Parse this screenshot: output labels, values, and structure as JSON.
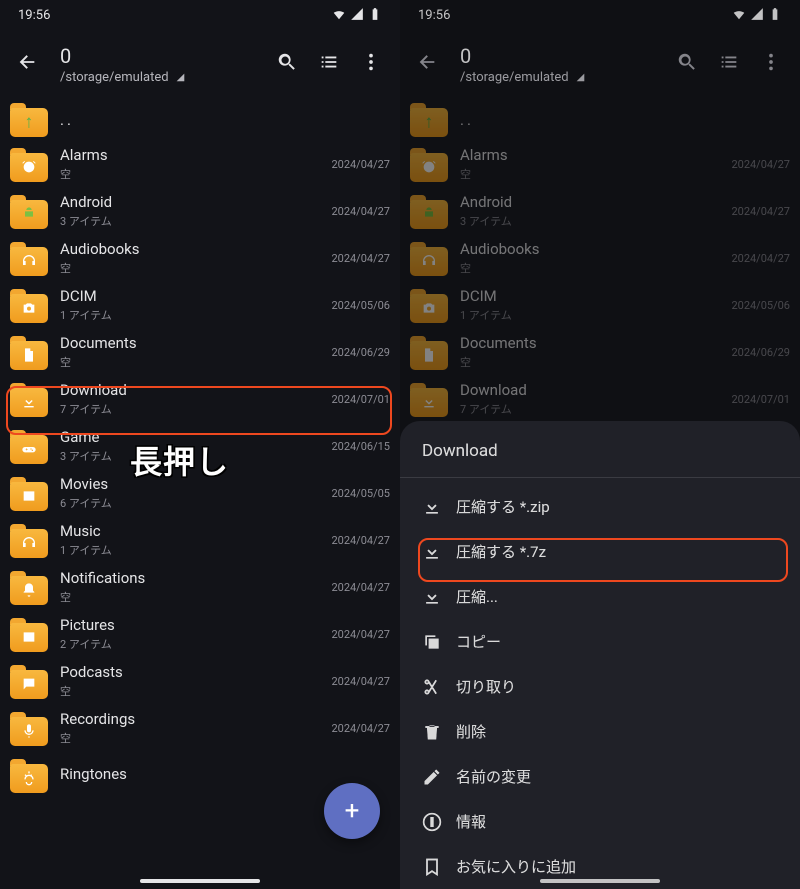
{
  "statusbar": {
    "time": "19:56"
  },
  "header": {
    "title": "0",
    "path": "/storage/emulated",
    "up_label": ".."
  },
  "folders": [
    {
      "name": "Alarms",
      "sub": "空",
      "date": "2024/04/27",
      "icon": "alarm"
    },
    {
      "name": "Android",
      "sub": "3 アイテム",
      "date": "2024/04/27",
      "icon": "android"
    },
    {
      "name": "Audiobooks",
      "sub": "空",
      "date": "2024/04/27",
      "icon": "headphones"
    },
    {
      "name": "DCIM",
      "sub": "1 アイテム",
      "date": "2024/05/06",
      "icon": "camera"
    },
    {
      "name": "Documents",
      "sub": "空",
      "date": "2024/06/29",
      "icon": "document"
    },
    {
      "name": "Download",
      "sub": "7 アイテム",
      "date": "2024/07/01",
      "icon": "download"
    },
    {
      "name": "Game",
      "sub": "3 アイテム",
      "date": "2024/06/15",
      "icon": "game"
    },
    {
      "name": "Movies",
      "sub": "6 アイテム",
      "date": "2024/05/05",
      "icon": "movie"
    },
    {
      "name": "Music",
      "sub": "1 アイテム",
      "date": "2024/04/27",
      "icon": "headphones"
    },
    {
      "name": "Notifications",
      "sub": "空",
      "date": "2024/04/27",
      "icon": "bell"
    },
    {
      "name": "Pictures",
      "sub": "2 アイテム",
      "date": "2024/04/27",
      "icon": "picture"
    },
    {
      "name": "Podcasts",
      "sub": "空",
      "date": "2024/04/27",
      "icon": "chat"
    },
    {
      "name": "Recordings",
      "sub": "空",
      "date": "2024/04/27",
      "icon": "mic"
    },
    {
      "name": "Ringtones",
      "sub": "",
      "date": "",
      "icon": "ring"
    }
  ],
  "annotation": {
    "longpress": "長押し"
  },
  "sheet": {
    "title": "Download",
    "items": [
      {
        "label": "圧縮する *.zip",
        "icon": "download-arrow"
      },
      {
        "label": "圧縮する *.7z",
        "icon": "download-arrow"
      },
      {
        "label": "圧縮...",
        "icon": "download-arrow"
      },
      {
        "label": "コピー",
        "icon": "copy"
      },
      {
        "label": "切り取り",
        "icon": "cut"
      },
      {
        "label": "削除",
        "icon": "trash"
      },
      {
        "label": "名前の変更",
        "icon": "pencil"
      },
      {
        "label": "情報",
        "icon": "info"
      },
      {
        "label": "お気に入りに追加",
        "icon": "bookmark"
      }
    ]
  }
}
